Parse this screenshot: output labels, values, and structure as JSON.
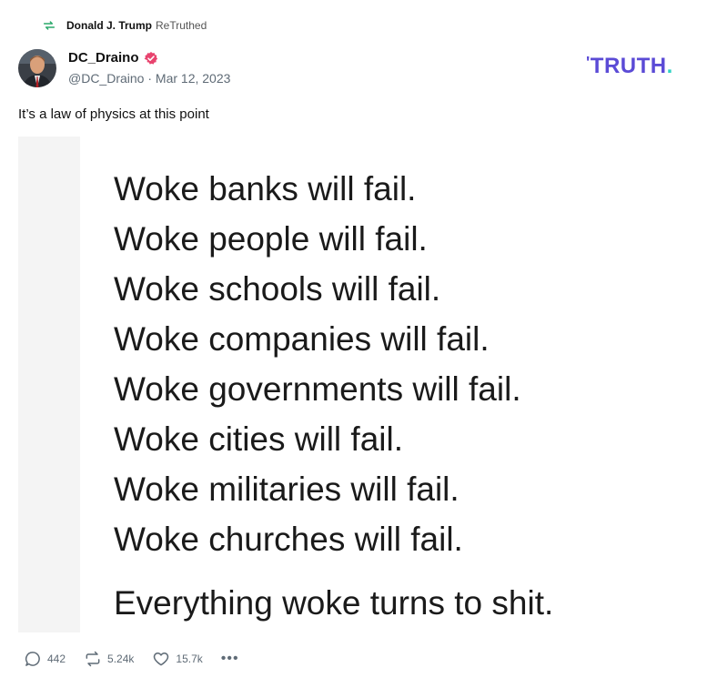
{
  "retruth": {
    "user": "Donald J. Trump",
    "label": "ReTruthed"
  },
  "author": {
    "name": "DC_Draino",
    "handle": "@DC_Draino",
    "date": "Mar 12, 2023"
  },
  "brand": {
    "logo_text": "TRUTH",
    "logo_dot": ".",
    "primary": "#5b4bd6",
    "accent": "#2fd3c4"
  },
  "post": {
    "text": "It’s a law of physics at this point",
    "image_lines": [
      "Woke banks will fail.",
      "Woke people will fail.",
      "Woke schools will fail.",
      "Woke companies will fail.",
      "Woke governments will fail.",
      "Woke cities will fail.",
      "Woke militaries will fail.",
      "Woke churches will fail."
    ],
    "image_final": "Everything woke turns to shit."
  },
  "stats": {
    "replies": "442",
    "retruths": "5.24k",
    "likes": "15.7k",
    "more": "•••"
  },
  "icons": {
    "retruth": "retruth-icon",
    "verified": "verified-badge-icon",
    "reply": "reply-icon",
    "like": "heart-icon",
    "more": "more-icon"
  }
}
